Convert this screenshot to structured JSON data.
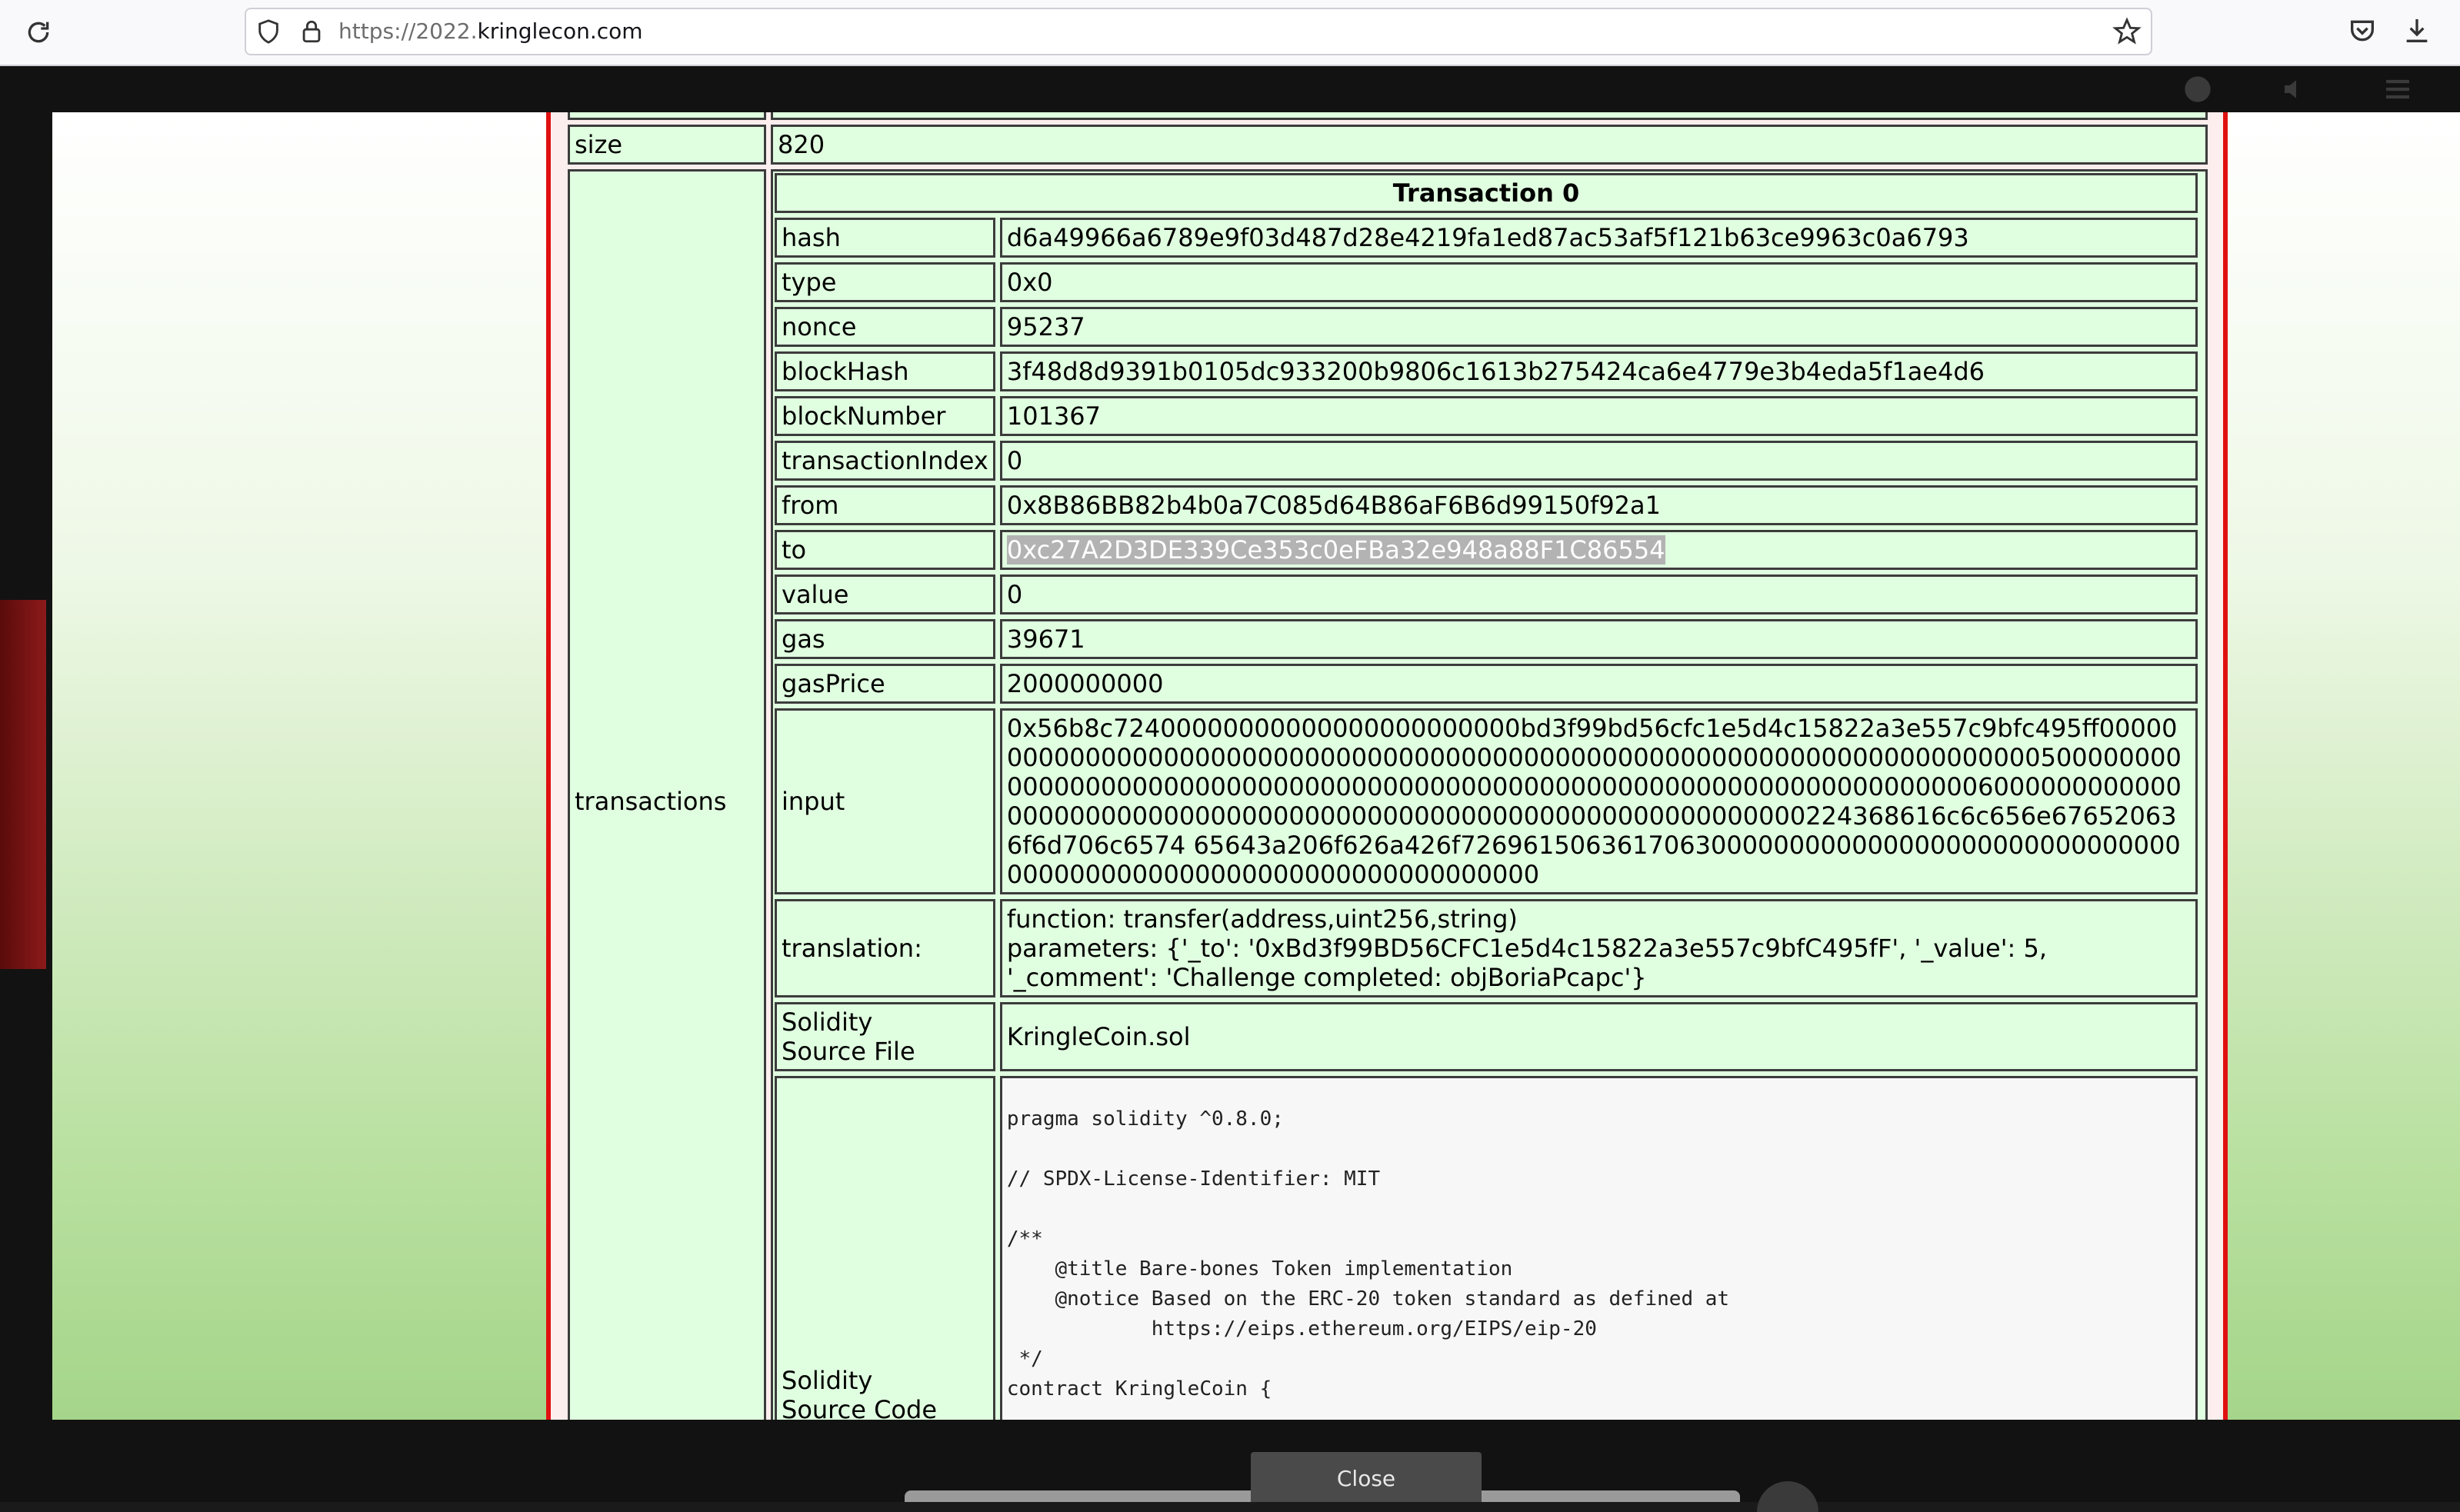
{
  "browser": {
    "url_prefix": "https://2022.",
    "url_domain": "kringlecon.com",
    "icons": [
      "reload-icon",
      "shield-icon",
      "lock-icon",
      "star-icon",
      "pocket-icon",
      "download-icon"
    ]
  },
  "block": {
    "size_label": "size",
    "size_value": "820",
    "transactions_label": "transactions"
  },
  "transaction": {
    "title": "Transaction 0",
    "rows": [
      {
        "key": "hash",
        "value": "d6a49966a6789e9f03d487d28e4219fa1ed87ac53af5f121b63ce9963c0a6793"
      },
      {
        "key": "type",
        "value": "0x0"
      },
      {
        "key": "nonce",
        "value": "95237"
      },
      {
        "key": "blockHash",
        "value": "3f48d8d9391b0105dc933200b9806c1613b275424ca6e4779e3b4eda5f1ae4d6"
      },
      {
        "key": "blockNumber",
        "value": "101367"
      },
      {
        "key": "transactionIndex",
        "value": "0"
      },
      {
        "key": "from",
        "value": "0x8B86BB82b4b0a7C085d64B86aF6B6d99150f92a1"
      },
      {
        "key": "to",
        "value": "0xc27A2D3DE339Ce353c0eFBa32e948a88F1C86554"
      },
      {
        "key": "value",
        "value": "0"
      },
      {
        "key": "gas",
        "value": "39671"
      },
      {
        "key": "gasPrice",
        "value": "2000000000"
      }
    ],
    "input_label": "input",
    "input_value": "0x56b8c72400000000000000000000000bd3f99bd56cfc1e5d4c15822a3e557c9bfc495ff00000000000000000000000000000000000000000000000000000000000000000000000500000000000000000000000000000000000000000000000000000000000000000000006000000000000000000000000000000000000000000000000000000000000000224368616c6c656e676520636f6d706c6574 65643a206f626a426f72696150636170630000000000000000000000000000000000000000000000000000000000000000",
    "translation_label": "translation:",
    "translation_function": "function: transfer(address,uint256,string)",
    "translation_parameters": "parameters: {'_to': '0xBd3f99BD56CFC1e5d4c15822a3e557c9bfC495fF', '_value': 5, '_comment': 'Challenge completed: objBoriaPcapc'}",
    "source_file_label_1": "Solidity",
    "source_file_label_2": "Source File",
    "source_file_value": "KringleCoin.sol",
    "source_code_label_1": "Solidity",
    "source_code_label_2": "Source Code",
    "source_code": "pragma solidity ^0.8.0;\n\n// SPDX-License-Identifier: MIT\n\n/**\n    @title Bare-bones Token implementation\n    @notice Based on the ERC-20 token standard as defined at\n            https://eips.ethereum.org/EIPS/eip-20\n */\ncontract KringleCoin {"
  },
  "modal": {
    "close_label": "Close"
  }
}
